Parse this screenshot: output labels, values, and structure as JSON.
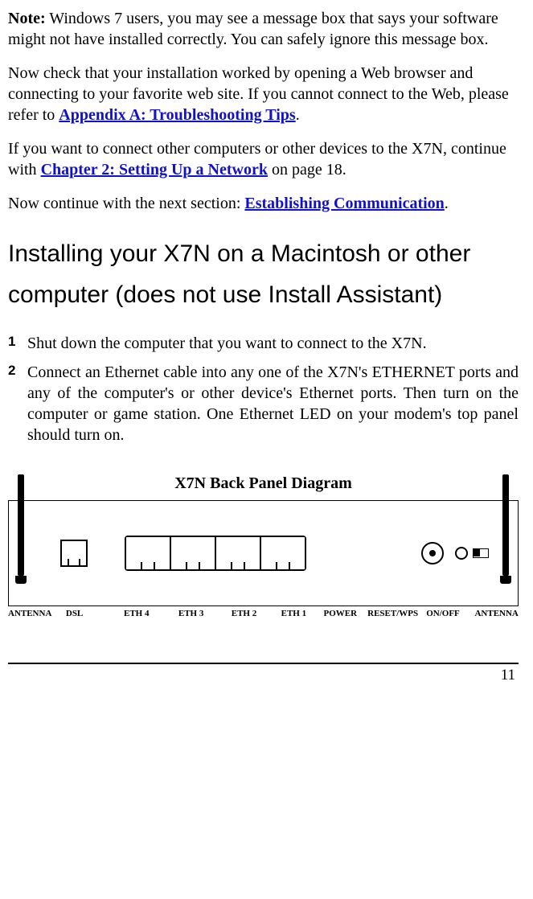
{
  "notePara": {
    "noteLabel": "Note:",
    "noteText": " Windows 7 users, you may see a message box that says your software might not have installed correctly. You can safely ignore this message box."
  },
  "checkInstall": {
    "pre": "Now check that your installation worked by opening a Web browser and connecting to your favorite web site. If you cannot connect to the Web, please refer to ",
    "link": "Appendix A: Troubleshooting Tips",
    "post": "."
  },
  "connectOther": {
    "pre": "If you want to connect other computers or other devices to the X7N, continue with ",
    "link": "Chapter 2: Setting Up a Network",
    "post": " on page 18."
  },
  "continueNext": {
    "pre": "Now continue with the next section: ",
    "link": "Establishing Communication",
    "post": "."
  },
  "heading": "Installing your X7N on a Macintosh or other computer (does not use Install Assistant)",
  "steps": [
    "Shut down the computer that you want to connect to the X7N.",
    "Connect an Ethernet cable into any one of the X7N's ETHERNET ports and any of the computer's or other device's Ethernet ports. Then turn on the computer or game station. One Ethernet LED on your modem's top panel should turn on."
  ],
  "diagramTitle": "X7N Back Panel Diagram",
  "panelLabels": {
    "antennaL": "ANTENNA",
    "dsl": "DSL",
    "eth4": "ETH 4",
    "eth3": "ETH 3",
    "eth2": "ETH 2",
    "eth1": "ETH 1",
    "power": "POWER",
    "reset": "RESET/WPS",
    "onoff": "ON/OFF",
    "antennaR": "ANTENNA"
  },
  "pageNumber": "11"
}
